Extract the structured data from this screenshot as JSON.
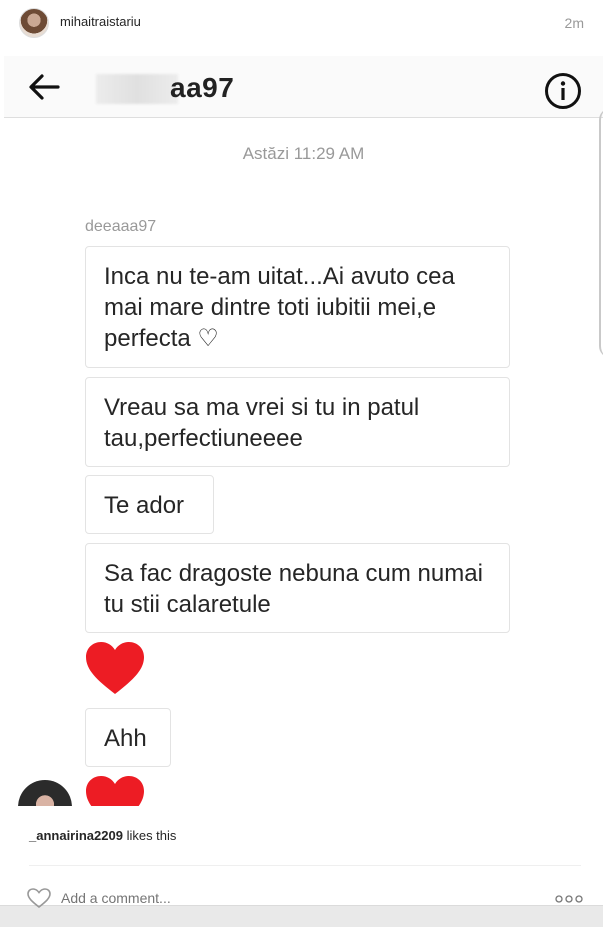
{
  "post": {
    "username": "mihaitraistariu",
    "time": "2m"
  },
  "chat": {
    "title": "aa97",
    "timestamp": "Astăzi 11:29 AM",
    "sender": "deeaaa97",
    "messages": [
      "Inca nu te-am uitat...Ai avuto cea mai mare dintre toti iubitii mei,e perfecta ♡",
      "Vreau sa ma vrei si tu in patul tau,perfectiuneeee",
      "Te ador",
      "Sa fac dragoste nebuna cum numai tu stii calaretule",
      "Ahh"
    ],
    "heart_color": "#ed1c24"
  },
  "likes": {
    "user": "_annairina2209",
    "suffix": " likes this"
  },
  "comment": {
    "placeholder": "Add a comment..."
  }
}
